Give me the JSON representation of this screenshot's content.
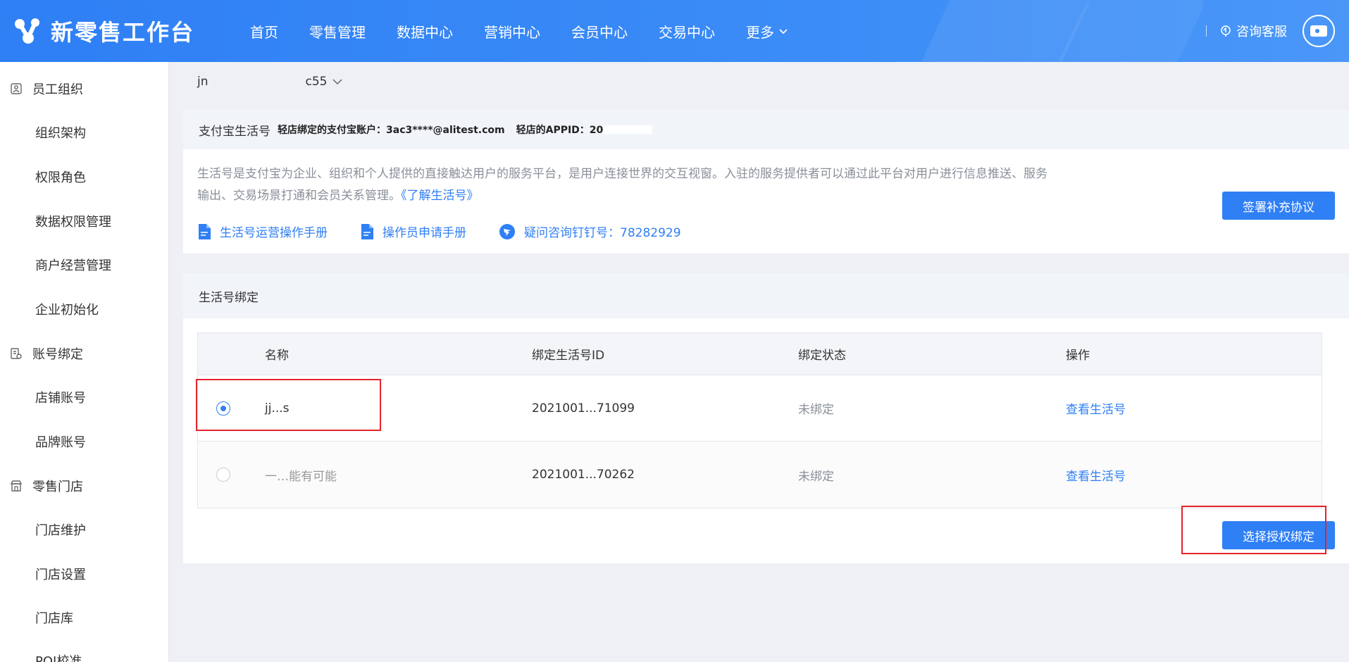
{
  "header": {
    "logo_text": "新零售工作台",
    "nav": [
      {
        "label": "首页"
      },
      {
        "label": "零售管理"
      },
      {
        "label": "数据中心"
      },
      {
        "label": "营销中心"
      },
      {
        "label": "会员中心"
      },
      {
        "label": "交易中心"
      },
      {
        "label": "更多"
      }
    ],
    "service_label": "咨询客服"
  },
  "sidebar": {
    "groups": [
      {
        "label": "员工组织",
        "icon": "user-card-icon",
        "children": [
          "组织架构",
          "权限角色",
          "数据权限管理",
          "商户经营管理",
          "企业初始化"
        ]
      },
      {
        "label": "账号绑定",
        "icon": "account-bind-icon",
        "children": [
          "店铺账号",
          "品牌账号"
        ]
      },
      {
        "label": "零售门店",
        "icon": "store-icon",
        "children": [
          "门店维护",
          "门店设置",
          "门店库",
          "POI校准"
        ]
      }
    ]
  },
  "store_selector": {
    "prefix": "jn",
    "suffix": "c55"
  },
  "info_card": {
    "title": "支付宝生活号",
    "account_text": "轻店绑定的支付宝账户：3ac3****@alitest.com",
    "appid_text": "轻店的APPID：20",
    "description": "生活号是支付宝为企业、组织和个人提供的直接触达用户的服务平台，是用户连接世界的交互视窗。入驻的服务提供者可以通过此平台对用户进行信息推送、服务输出、交易场景打通和会员关系管理。",
    "learn_link": "《了解生活号》",
    "links": [
      {
        "label": "生活号运营操作手册",
        "icon": "document-icon"
      },
      {
        "label": "操作员申请手册",
        "icon": "document-icon"
      },
      {
        "label": "疑问咨询钉钉号：78282929",
        "icon": "dingtalk-icon"
      }
    ],
    "sign_button": "签署补充协议"
  },
  "bind_card": {
    "title": "生活号绑定",
    "columns": [
      "名称",
      "绑定生活号ID",
      "绑定状态",
      "操作"
    ],
    "rows": [
      {
        "selected": true,
        "name": "jj...s",
        "id": "2021001...71099",
        "status": "未绑定",
        "action": "查看生活号"
      },
      {
        "selected": false,
        "name": "一…能有可能",
        "id": "2021001...70262",
        "status": "未绑定",
        "action": "查看生活号"
      }
    ],
    "bind_button": "选择授权绑定"
  },
  "colors": {
    "primary": "#2f7ff5",
    "highlight": "#e4232d"
  }
}
